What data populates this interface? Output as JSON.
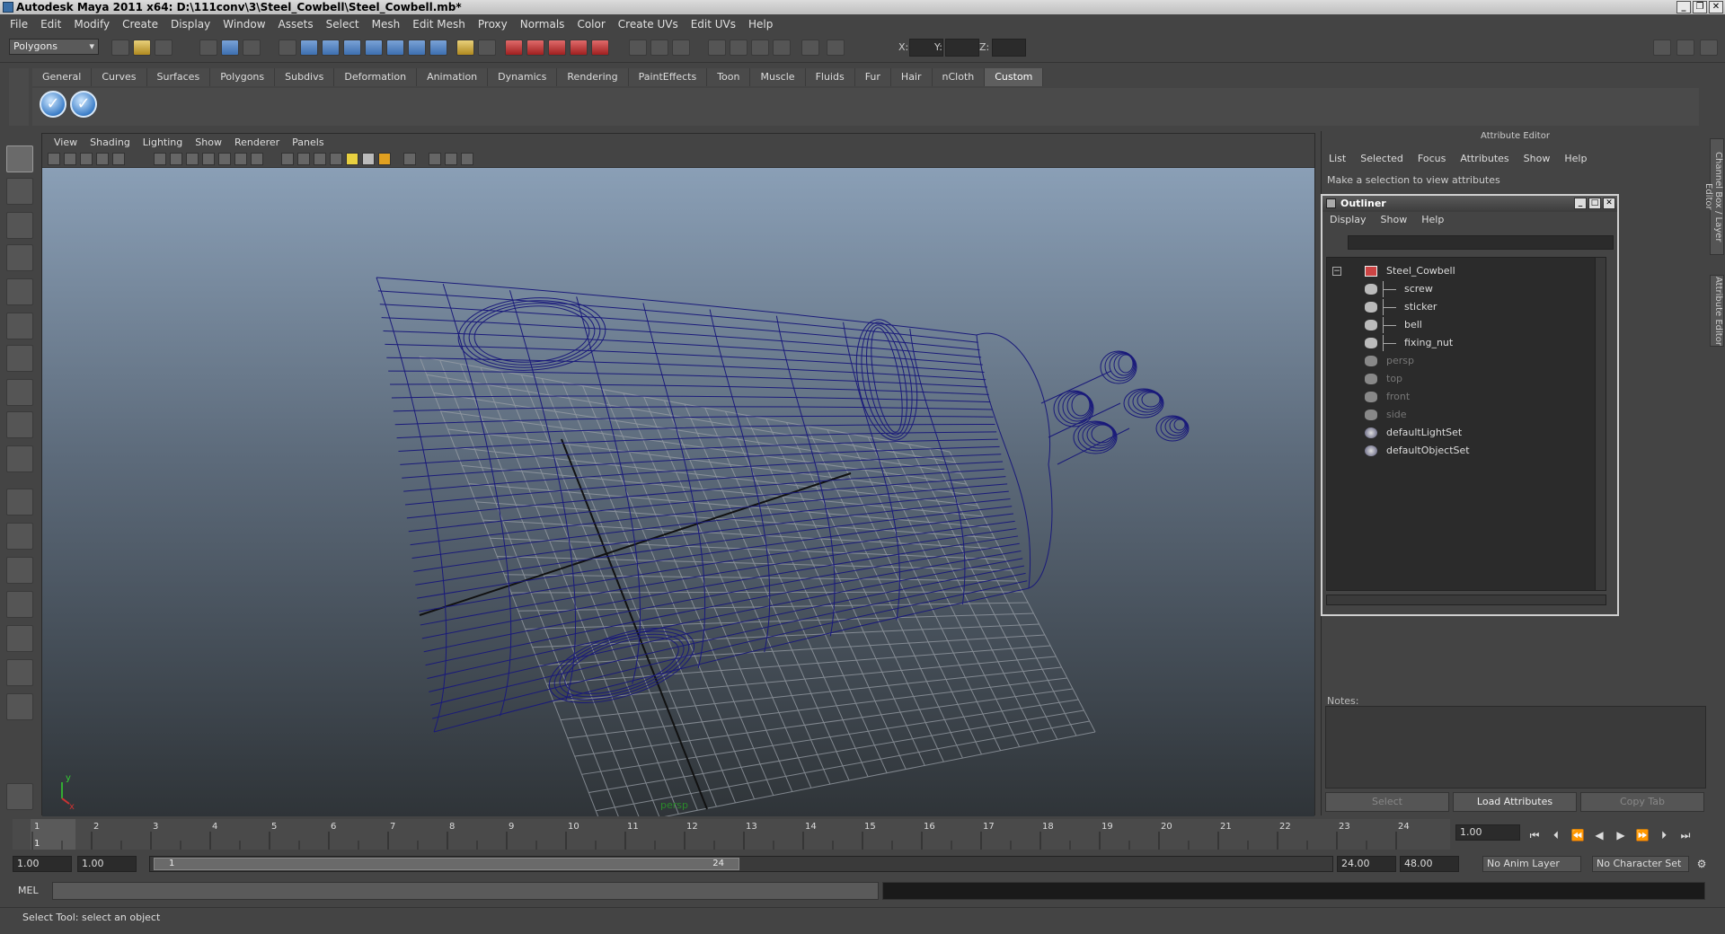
{
  "window": {
    "title": "Autodesk Maya 2011 x64: D:\\111conv\\3\\Steel_Cowbell\\Steel_Cowbell.mb*",
    "minimize": "_",
    "restore": "❐",
    "close": "✕"
  },
  "menubar": [
    "File",
    "Edit",
    "Modify",
    "Create",
    "Display",
    "Window",
    "Assets",
    "Select",
    "Mesh",
    "Edit Mesh",
    "Proxy",
    "Normals",
    "Color",
    "Create UVs",
    "Edit UVs",
    "Help"
  ],
  "statusline": {
    "mode": "Polygons",
    "x_label": "X:",
    "y_label": "Y:",
    "z_label": "Z:"
  },
  "shelf": {
    "tabs": [
      "General",
      "Curves",
      "Surfaces",
      "Polygons",
      "Subdivs",
      "Deformation",
      "Animation",
      "Dynamics",
      "Rendering",
      "PaintEffects",
      "Toon",
      "Muscle",
      "Fluids",
      "Fur",
      "Hair",
      "nCloth",
      "Custom"
    ],
    "active_tab": "Custom",
    "buttons": [
      "check-icon",
      "check-icon"
    ]
  },
  "viewport": {
    "menu": [
      "View",
      "Shading",
      "Lighting",
      "Show",
      "Renderer",
      "Panels"
    ],
    "camera": "persp",
    "axis_x": "x",
    "axis_y": "y",
    "wire_color": "#1a1a7a"
  },
  "attribute_editor": {
    "title": "Attribute Editor",
    "menu": [
      "List",
      "Selected",
      "Focus",
      "Attributes",
      "Show",
      "Help"
    ],
    "message": "Make a selection to view attributes",
    "notes_label": "Notes:",
    "select_button": "Select",
    "load_button": "Load Attributes",
    "copy_button": "Copy Tab"
  },
  "side_tabs": [
    "Channel Box / Layer Editor",
    "Attribute Editor"
  ],
  "outliner": {
    "title": "Outliner",
    "menu": [
      "Display",
      "Show",
      "Help"
    ],
    "items": [
      {
        "label": "Steel_Cowbell",
        "type": "group",
        "depth": 0
      },
      {
        "label": "screw",
        "type": "mesh",
        "depth": 1
      },
      {
        "label": "sticker",
        "type": "mesh",
        "depth": 1
      },
      {
        "label": "bell",
        "type": "mesh",
        "depth": 1
      },
      {
        "label": "fixing_nut",
        "type": "mesh",
        "depth": 1
      },
      {
        "label": "persp",
        "type": "camera",
        "depth": 0
      },
      {
        "label": "top",
        "type": "camera",
        "depth": 0
      },
      {
        "label": "front",
        "type": "camera",
        "depth": 0
      },
      {
        "label": "side",
        "type": "camera",
        "depth": 0
      },
      {
        "label": "defaultLightSet",
        "type": "set",
        "depth": 0
      },
      {
        "label": "defaultObjectSet",
        "type": "set",
        "depth": 0
      }
    ]
  },
  "timeline": {
    "ticks": [
      "1",
      "2",
      "3",
      "4",
      "5",
      "6",
      "7",
      "8",
      "9",
      "10",
      "11",
      "12",
      "13",
      "14",
      "15",
      "16",
      "17",
      "18",
      "19",
      "20",
      "21",
      "22",
      "23",
      "24"
    ],
    "current_marker": "1",
    "current_frame": "1.00"
  },
  "range": {
    "start": "1.00",
    "playback_start": "1.00",
    "thumb_start": "1",
    "thumb_end": "24",
    "playback_end": "24.00",
    "end": "48.00",
    "anim_layer": "No Anim Layer",
    "character_set": "No Character Set"
  },
  "command": {
    "label": "MEL"
  },
  "help_line": "Select Tool: select an object"
}
